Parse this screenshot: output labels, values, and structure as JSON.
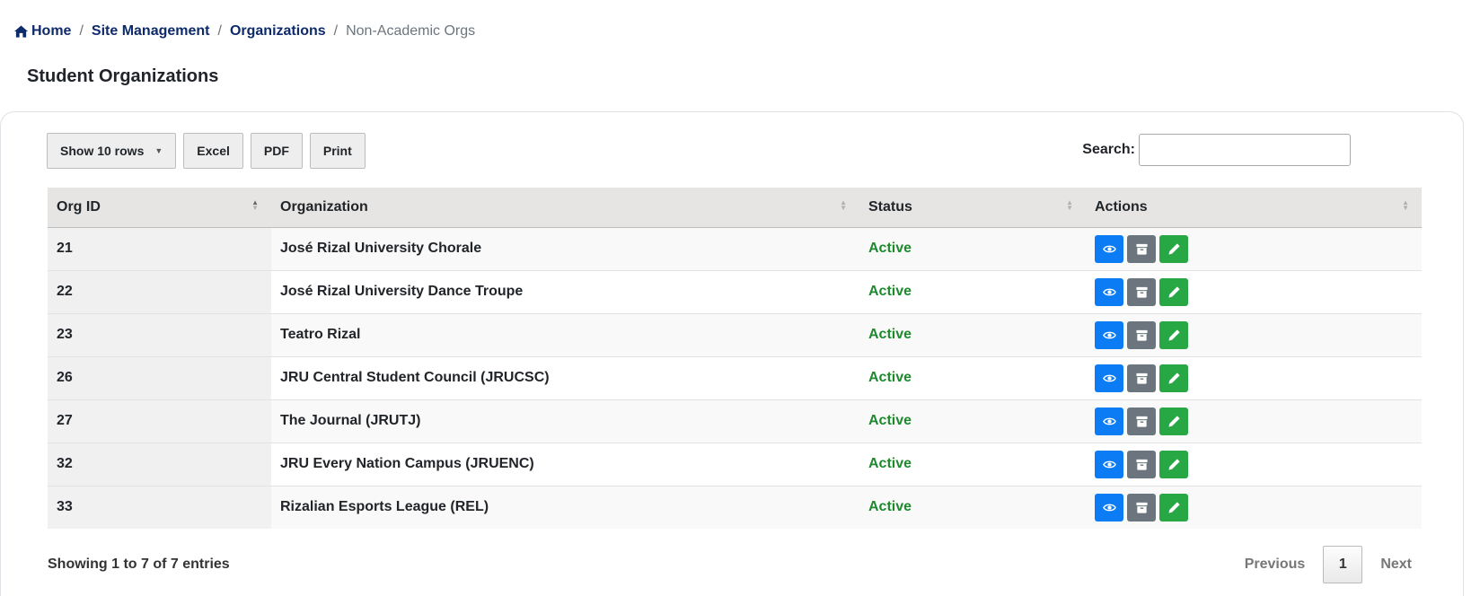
{
  "breadcrumb": {
    "home": "Home",
    "site_management": "Site Management",
    "organizations": "Organizations",
    "current": "Non-Academic Orgs"
  },
  "page_title": "Student Organizations",
  "toolbar": {
    "show_rows": "Show 10 rows",
    "excel": "Excel",
    "pdf": "PDF",
    "print": "Print"
  },
  "search": {
    "label": "Search:",
    "value": "",
    "placeholder": ""
  },
  "table": {
    "columns": [
      "Org ID",
      "Organization",
      "Status",
      "Actions"
    ],
    "rows": [
      {
        "id": "21",
        "name": "José Rizal University Chorale",
        "status": "Active"
      },
      {
        "id": "22",
        "name": "José Rizal University Dance Troupe",
        "status": "Active"
      },
      {
        "id": "23",
        "name": "Teatro Rizal",
        "status": "Active"
      },
      {
        "id": "26",
        "name": "JRU Central Student Council (JRUCSC)",
        "status": "Active"
      },
      {
        "id": "27",
        "name": "The Journal (JRUTJ)",
        "status": "Active"
      },
      {
        "id": "32",
        "name": "JRU Every Nation Campus (JRUENC)",
        "status": "Active"
      },
      {
        "id": "33",
        "name": "Rizalian Esports League (REL)",
        "status": "Active"
      }
    ],
    "action_icons": [
      "eye-icon",
      "archive-icon",
      "pencil-icon"
    ]
  },
  "info": "Showing 1 to 7 of 7 entries",
  "pagination": {
    "previous": "Previous",
    "current": "1",
    "next": "Next"
  },
  "colors": {
    "link": "#0d2a6b",
    "status_active": "#1e8a2e",
    "view_button": "#0b7cf4",
    "archive_button": "#6c757d",
    "edit_button": "#28a745"
  }
}
